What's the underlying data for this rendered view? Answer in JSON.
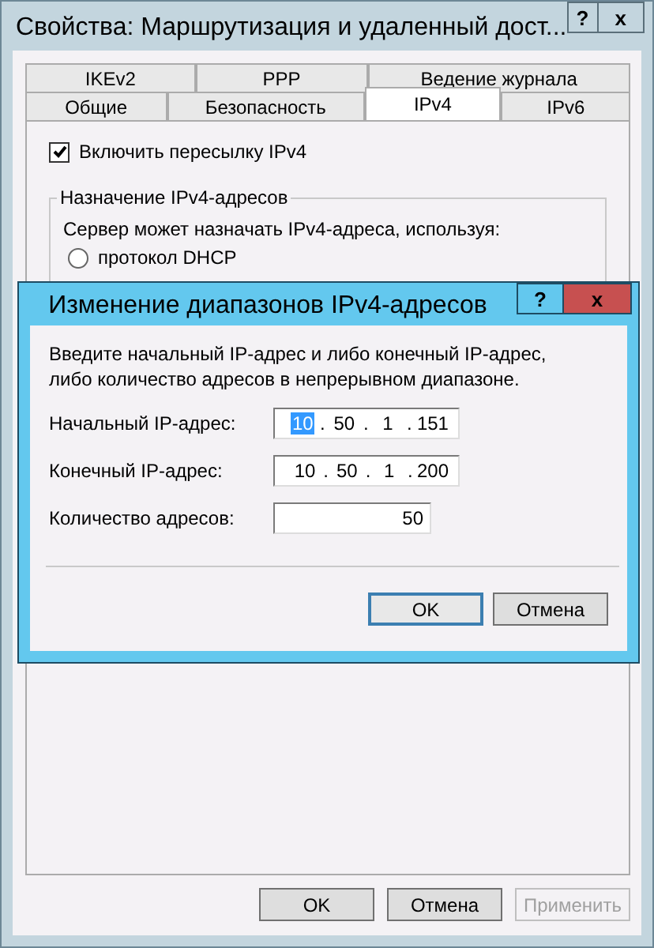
{
  "window": {
    "title": "Свойства: Маршрутизация и удаленный дост...",
    "help": "?",
    "close": "x"
  },
  "tab_rows": [
    [
      {
        "label": "IKEv2",
        "selected": false
      },
      {
        "label": "PPP",
        "selected": false
      },
      {
        "label": "Ведение журнала",
        "selected": false
      }
    ],
    [
      {
        "label": "Общие",
        "selected": false
      },
      {
        "label": "Безопасность",
        "selected": false
      },
      {
        "label": "IPv4",
        "selected": true
      },
      {
        "label": "IPv6",
        "selected": false
      }
    ]
  ],
  "forwarding": {
    "label": "Включить пересылку IPv4",
    "checked": true
  },
  "group": {
    "title": "Назначение IPv4-адресов",
    "text": "Сервер может назначать IPv4-адреса, используя:",
    "radio": {
      "label": "протокол DHCP",
      "selected": false
    }
  },
  "buttons": [
    {
      "label": "OK",
      "disabled": false
    },
    {
      "label": "Отмена",
      "disabled": false
    },
    {
      "label": "Применить",
      "disabled": true
    }
  ],
  "dialog": {
    "title": "Изменение диапазонов IPv4-адресов",
    "help": "?",
    "close": "x",
    "text": "Введите начальный IP-адрес и либо конечный IP-адрес, либо количество адресов в непрерывном диапазоне.",
    "fields": [
      {
        "kind": "ip",
        "label": "Начальный IP-адрес:",
        "separator": ".",
        "octets": [
          {
            "text": "10",
            "selected": true
          },
          {
            "text": "50",
            "selected": false
          },
          {
            "text": "1",
            "selected": false
          },
          {
            "text": "151",
            "selected": false
          }
        ]
      },
      {
        "kind": "ip",
        "label": "Конечный IP-адрес:",
        "separator": ".",
        "octets": [
          {
            "text": "10",
            "selected": false
          },
          {
            "text": "50",
            "selected": false
          },
          {
            "text": "1",
            "selected": false
          },
          {
            "text": "200",
            "selected": false
          }
        ]
      },
      {
        "kind": "number",
        "label": "Количество адресов:",
        "value": "50"
      }
    ],
    "buttons": [
      {
        "label": "OK",
        "default": true
      },
      {
        "label": "Отмена",
        "default": false
      }
    ]
  }
}
